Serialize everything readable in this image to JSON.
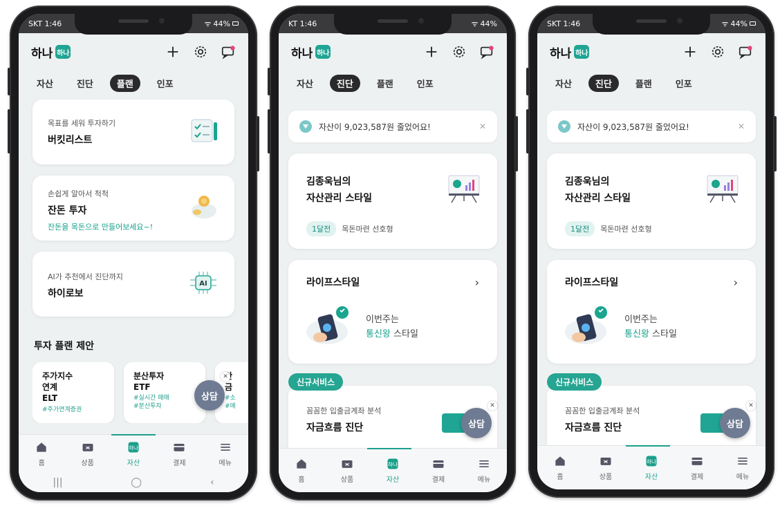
{
  "colors": {
    "accent": "#20a594",
    "dark": "#2a2a2c",
    "fab": "#6f7b93"
  },
  "phones": [
    {
      "status": {
        "time": "SKT 1:46",
        "battery": "44%"
      },
      "brand": {
        "text": "하나",
        "logo": "하나"
      },
      "tabs": [
        "자산",
        "진단",
        "플랜",
        "인포"
      ],
      "active_tab": "플랜",
      "cards": [
        {
          "sub": "목표를 세워 투자하기",
          "title": "버킷리스트",
          "link": "",
          "icon": "checklist-icon"
        },
        {
          "sub": "손쉽게 알아서 척척",
          "title": "잔돈 투자",
          "link": "잔돈을 목돈으로 만들어보세요~!",
          "icon": "piggy-bank-icon"
        },
        {
          "sub": "AI가 추천에서 진단까지",
          "title": "하이로보",
          "link": "",
          "icon": "ai-chip-icon"
        }
      ],
      "section": "투자 플랜 제안",
      "plan_cards": [
        {
          "title": "주가지수\n연계\nELT",
          "hashtag": "#주가연계증권"
        },
        {
          "title": "분산투자\nETF",
          "hashtag": "#실시간 매매\n#분산투자"
        },
        {
          "title": "안\n금",
          "hashtag": "#소\n#매"
        }
      ],
      "fab": "상담",
      "nav": [
        "홈",
        "상품",
        "자산",
        "결제",
        "메뉴"
      ],
      "active_nav": "자산"
    },
    {
      "status": {
        "time": "KT 1:46",
        "battery": "44%"
      },
      "brand": {
        "text": "하나",
        "logo": "하나"
      },
      "tabs": [
        "자산",
        "진단",
        "플랜",
        "인포"
      ],
      "active_tab": "진단",
      "banner": "자산이 9,023,587원 줄었어요!",
      "style_card": {
        "title_line1": "김종욱님의",
        "title_line2": "자산관리 스타일",
        "pill": "1달전",
        "type": "목돈마련 선호형"
      },
      "life_card": {
        "title": "라이프스타일",
        "line1": "이번주는",
        "highlight": "통신왕",
        "suffix": " 스타일"
      },
      "new_tag": "신규서비스",
      "cash_card": {
        "sub": "꼼꼼한 입출금계좌 분석",
        "title": "자금흐름 진단"
      },
      "fab": "상담",
      "nav": [
        "홈",
        "상품",
        "자산",
        "결제",
        "메뉴"
      ],
      "active_nav": "자산"
    },
    {
      "status": {
        "time": "SKT 1:46",
        "battery": "44%"
      },
      "brand": {
        "text": "하나",
        "logo": "하나"
      },
      "tabs": [
        "자산",
        "진단",
        "플랜",
        "인포"
      ],
      "active_tab": "진단",
      "banner": "자산이 9,023,587원 줄었어요!",
      "style_card": {
        "title_line1": "김종욱님의",
        "title_line2": "자산관리 스타일",
        "pill": "1달전",
        "type": "목돈마련 선호형"
      },
      "life_card": {
        "title": "라이프스타일",
        "line1": "이번주는",
        "highlight": "통신왕",
        "suffix": " 스타일"
      },
      "new_tag": "신규서비스",
      "cash_card": {
        "sub": "꼼꼼한 입출금계좌 분석",
        "title": "자금흐름 진단"
      },
      "fab": "상담",
      "nav": [
        "홈",
        "상품",
        "자산",
        "결제",
        "메뉴"
      ],
      "active_nav": "자산"
    }
  ]
}
